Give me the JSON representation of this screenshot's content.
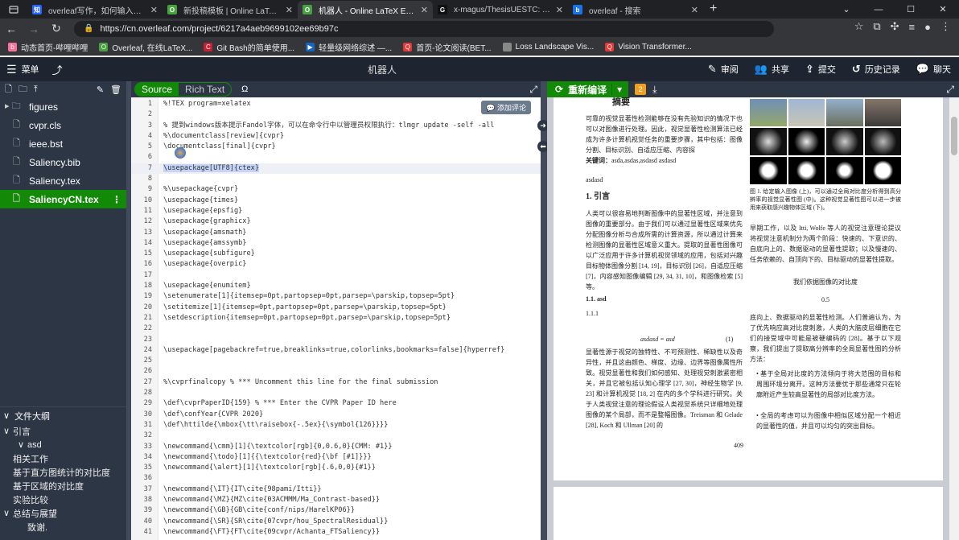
{
  "browser": {
    "tabs": [
      {
        "title": "overleaf写作，如何输入中文?",
        "icon_color": "#2962ff",
        "icon_text": "知"
      },
      {
        "title": "新投稿模板 | Online LaTeX Ed",
        "icon_color": "#47a141",
        "icon_text": "O"
      },
      {
        "title": "机器人 - Online LaTeX Editor Ov",
        "icon_color": "#47a141",
        "icon_text": "O"
      },
      {
        "title": "x-magus/ThesisUESTC: ThesisUE",
        "icon_color": "#111111",
        "icon_text": "G"
      },
      {
        "title": "overleaf - 搜索",
        "icon_color": "#1a73e8",
        "icon_text": "b"
      }
    ],
    "url": "https://cn.overleaf.com/project/6217a4aeb9699102ee69b97c",
    "bookmarks": [
      {
        "label": "动态首页-哔哩哔哩",
        "color": "#fb7299",
        "icon": "b"
      },
      {
        "label": "Overleaf, 在线LaTeX...",
        "color": "#47a141",
        "icon": "O"
      },
      {
        "label": "Git Bash的简单使用...",
        "color": "#c32136",
        "icon": "C"
      },
      {
        "label": "轻量级网络综述 —...",
        "color": "#1565c0",
        "icon": "▶"
      },
      {
        "label": "首页-论文阅读(BET...",
        "color": "#e53935",
        "icon": "Q"
      },
      {
        "label": "Loss Landscape Vis...",
        "color": "#888888",
        "icon": ""
      },
      {
        "label": "Vision Transformer...",
        "color": "#e53935",
        "icon": "Q"
      }
    ]
  },
  "overleaf": {
    "menu_label": "菜单",
    "project_name": "机器人",
    "actions": [
      "审阅",
      "共享",
      "提交",
      "历史记录",
      "聊天"
    ],
    "files": [
      {
        "name": "figures",
        "type": "folder"
      },
      {
        "name": "cvpr.cls",
        "type": "file"
      },
      {
        "name": "ieee.bst",
        "type": "file"
      },
      {
        "name": "Saliency.bib",
        "type": "file"
      },
      {
        "name": "Saliency.tex",
        "type": "file"
      },
      {
        "name": "SaliencyCN.tex",
        "type": "file",
        "selected": true
      }
    ],
    "outline_title": "文件大纲",
    "outline": [
      {
        "label": "引言",
        "level": 1,
        "arrow": "∨"
      },
      {
        "label": "asd",
        "level": 2,
        "arrow": "∨"
      },
      {
        "label": "相关工作",
        "level": 1,
        "arrow": ""
      },
      {
        "label": "基于直方图统计的对比度",
        "level": 1,
        "arrow": ""
      },
      {
        "label": "基于区域的对比度",
        "level": 1,
        "arrow": ""
      },
      {
        "label": "实验比较",
        "level": 1,
        "arrow": ""
      },
      {
        "label": "总结与展望",
        "level": 1,
        "arrow": "∨"
      },
      {
        "label": "致谢.",
        "level": 2,
        "arrow": ""
      }
    ],
    "editor": {
      "source_label": "Source",
      "richtext_label": "Rich Text",
      "add_comment": "添加评论",
      "lines": [
        "%!TEX program=xelatex",
        "",
        "% 提到windows版本提示Fandol字体，可以在命令行中以管理员权限执行：tlmgr update -self -all",
        "%\\documentclass[review]{cvpr}",
        "\\documentclass[final]{cvpr}",
        "",
        "\\usepackage[UTF8]{ctex}",
        "",
        "%\\usepackage{cvpr}",
        "\\usepackage{times}",
        "\\usepackage{epsfig}",
        "\\usepackage{graphicx}",
        "\\usepackage{amsmath}",
        "\\usepackage{amssymb}",
        "\\usepackage{subfigure}",
        "\\usepackage{overpic}",
        "",
        "\\usepackage{enumitem}",
        "\\setenumerate[1]{itemsep=0pt,partopsep=0pt,parsep=\\parskip,topsep=5pt}",
        "\\setitemize[1]{itemsep=0pt,partopsep=0pt,parsep=\\parskip,topsep=5pt}",
        "\\setdescription{itemsep=0pt,partopsep=0pt,parsep=\\parskip,topsep=5pt}",
        "",
        "",
        "\\usepackage[pagebackref=true,breaklinks=true,colorlinks,bookmarks=false]{hyperref}",
        "",
        "",
        "%\\cvprfinalcopy % *** Uncomment this line for the final submission",
        "",
        "\\def\\cvprPaperID{159} % *** Enter the CVPR Paper ID here",
        "\\def\\confYear{CVPR 2020}",
        "\\def\\httilde{\\mbox{\\tt\\raisebox{-.5ex}{\\symbol{126}}}}",
        "",
        "\\newcommand{\\cmm}[1]{\\textcolor[rgb]{0,0.6,0}{CMM: #1}}",
        "\\newcommand{\\todo}[1]{{\\textcolor{red}{\\bf [#1]}}}",
        "\\newcommand{\\alert}[1]{\\textcolor[rgb]{.6,0,0}{#1}}",
        "",
        "\\newcommand{\\IT}{IT\\cite{98pami/Itti}}",
        "\\newcommand{\\MZ}{MZ\\cite{03ACMMM/Ma_Contrast-based}}",
        "\\newcommand{\\GB}{GB\\cite{conf/nips/HarelKP06}}",
        "\\newcommand{\\SR}{SR\\cite{07cvpr/hou_SpectralResidual}}",
        "\\newcommand{\\FT}{FT\\cite{09cvpr/Achanta_FTSaliency}}"
      ]
    },
    "pdf": {
      "recompile_label": "重新编译",
      "badge": "2",
      "abstract_heading": "摘要",
      "abstract_text": "可靠的视觉显著性检测能够在没有先验知识的情况下也可以对图像进行处理。因此，视觉显著性检测算法已经成为许多计算机视觉任务的重要步骤，其中包括：图像分割、目标识别、自适应压缩、内容探",
      "keywords_label": "关键词：",
      "keywords": "asda,asdas,asdasd asdasd",
      "asdasd": "asdasd",
      "sec1": "1. 引言",
      "sec1_text": "人类可以很容易地判断图像中的显著性区域，并注意到图像的重要部分。由于我们可以通过显著性区域来优先分配图像分析与合成所需的计算资源，所以通过计算来检测图像的显著性区域意义重大。提取的显著性图像可以广泛应用于许多计算机视觉领域的应用，包括对兴趣目标物体图像分割 [14, 19]，目标识别 [26]，自适应压缩 [7]，内容感知图像编辑 [29, 34, 31, 10]，和图像检索 [5] 等。",
      "sub11": "1.1. asd",
      "sub111": "1.1.1",
      "equation": "asdasd = asd",
      "eq_number": "(1)",
      "para2": "显著性源于视觉的独特性、不可预测性、稀缺性以及奇异性，并且这由颜色、梯度、边缘、边界等图像属性所致。视觉显著性和我们如何感知、处理视觉刺激紧密相关，并且它被包括认知心理学 [27, 30]，神经生物学 [9, 23] 和计算机视觉 [18, 2] 在内的多个学科进行研究。关于人类视觉注意的理论假设人类视觉系统只详细地处理图像的某个局部，而不是整幅图像。Treisman 和 Gelade [28], Koch 和 Ullman [20] 的",
      "page_number": "409",
      "fig_caption": "图 1. 给定输入图像 (上)，可以通过全局对比度分析得到高分辨率的视觉显著性图 (中)。这种视觉显著性图可以进一步被用来获取感兴趣物体区域 (下)。",
      "right_para1": "早期工作，以及 Itti, Wolfe 等人的视觉注意理论提议将视觉注意机制分为两个阶段：快速的、下意识的、自底向上的、数据驱动的显著性提取；以及慢速的、任务依赖的、自顶向下的、目标驱动的显著性提取。",
      "right_center": "我们依据图像的对比度",
      "right_value": "0.5",
      "right_para2": "底向上、数据驱动的显著性检测。人们普遍认为，为了优先响应高对比度刺激，人类的大脑皮层细胞在它们的接受域中可能是被硬编码的 [28]。基于以下观察，我们提出了提取高分辨率的全局显著性图的分析方法：",
      "bullet1": "基于全局对比度的方法倾向于将大范围的目标和周围环境分离开。这种方法要优于那些通常只在轮廓附近产生较高显著性的局部对比度方法。",
      "bullet2": "全局的考虑可以为图像中相似区域分配一个相近的显著性的值，并且可以均匀的突出目标。"
    }
  }
}
